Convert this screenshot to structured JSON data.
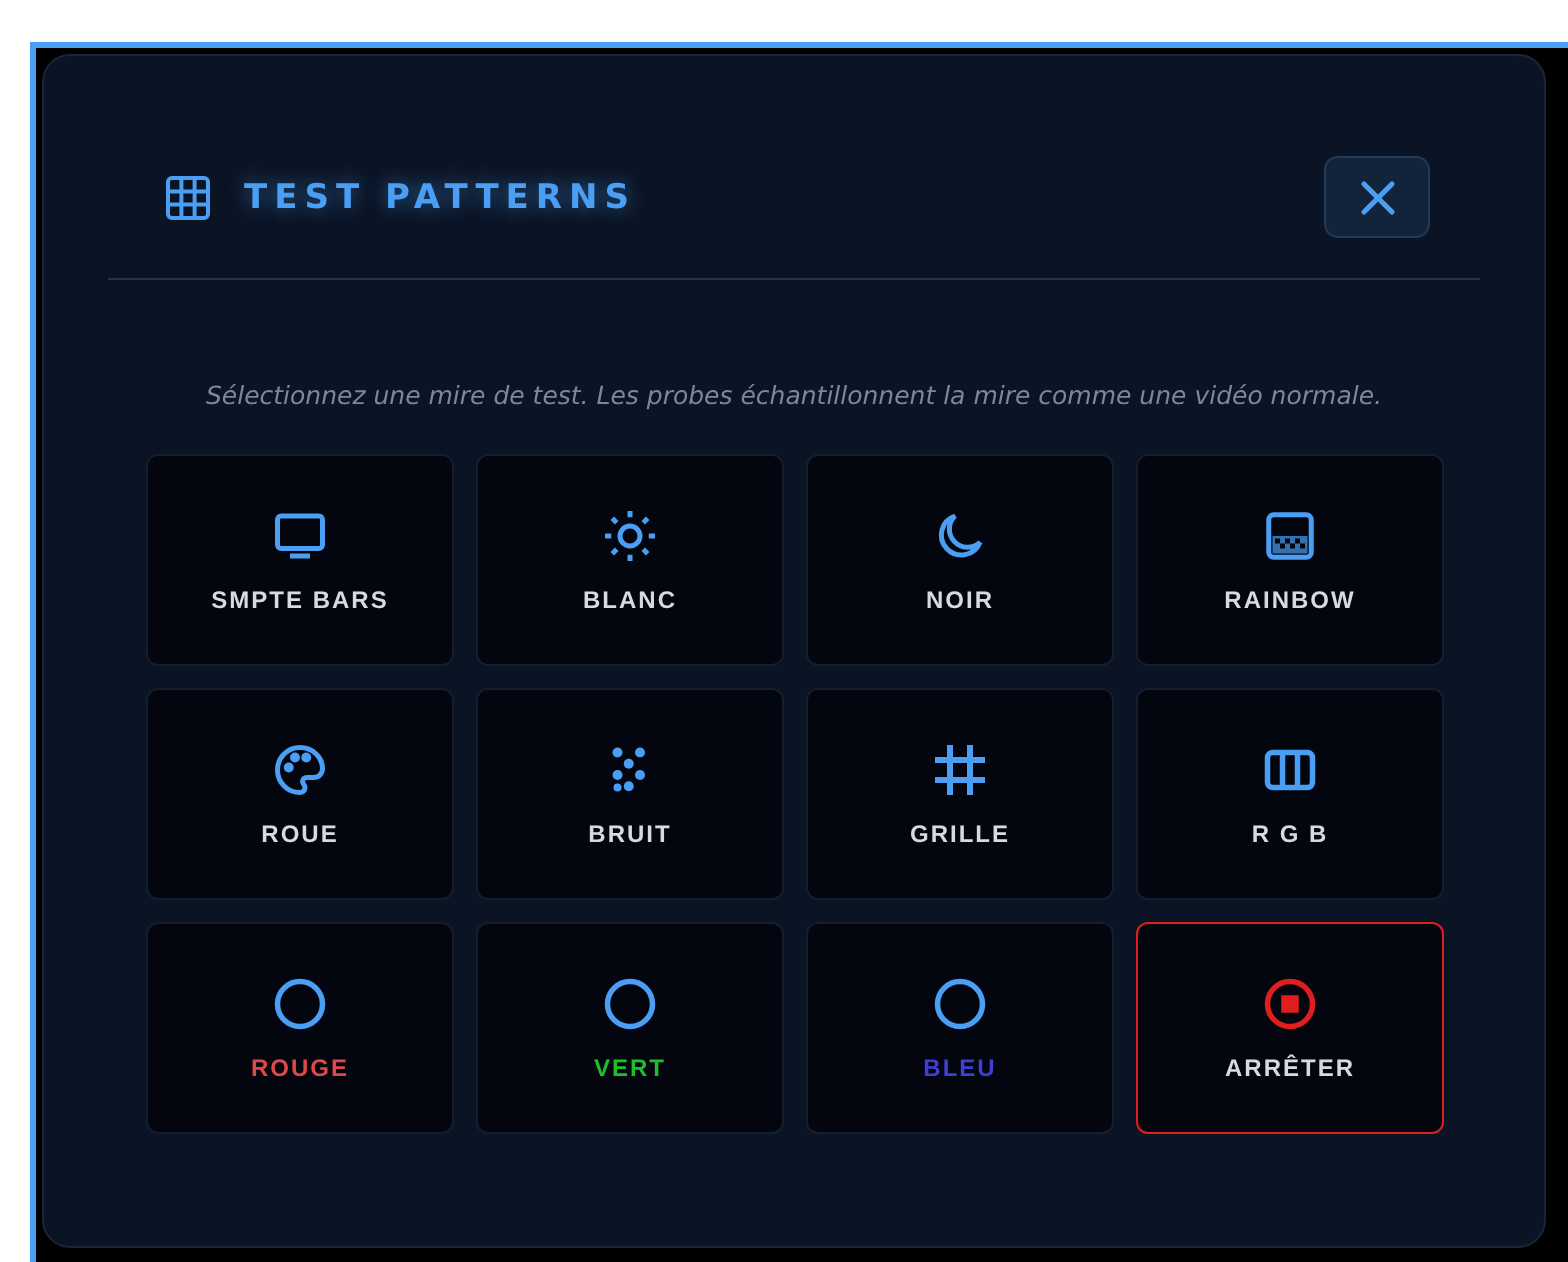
{
  "dialog": {
    "title": "TEST PATTERNS",
    "description": "Sélectionnez une mire de test. Les probes échantillonnent la mire comme une vidéo normale.",
    "patterns": [
      {
        "kind": "tv",
        "label": "SMPTE BARS"
      },
      {
        "kind": "sun",
        "label": "BLANC"
      },
      {
        "kind": "moon",
        "label": "NOIR"
      },
      {
        "kind": "gradient",
        "label": "RAINBOW"
      },
      {
        "kind": "palette",
        "label": "ROUE"
      },
      {
        "kind": "dots",
        "label": "BRUIT"
      },
      {
        "kind": "grid",
        "label": "GRILLE"
      },
      {
        "kind": "columns",
        "label": "R G B"
      },
      {
        "kind": "circle",
        "label": "ROUGE",
        "color": "#e04848"
      },
      {
        "kind": "circle",
        "label": "VERT",
        "color": "#1fbf2a"
      },
      {
        "kind": "circle",
        "label": "BLEU",
        "color": "#3f3fd6"
      },
      {
        "kind": "stop",
        "label": "ARRÊTER"
      }
    ]
  }
}
